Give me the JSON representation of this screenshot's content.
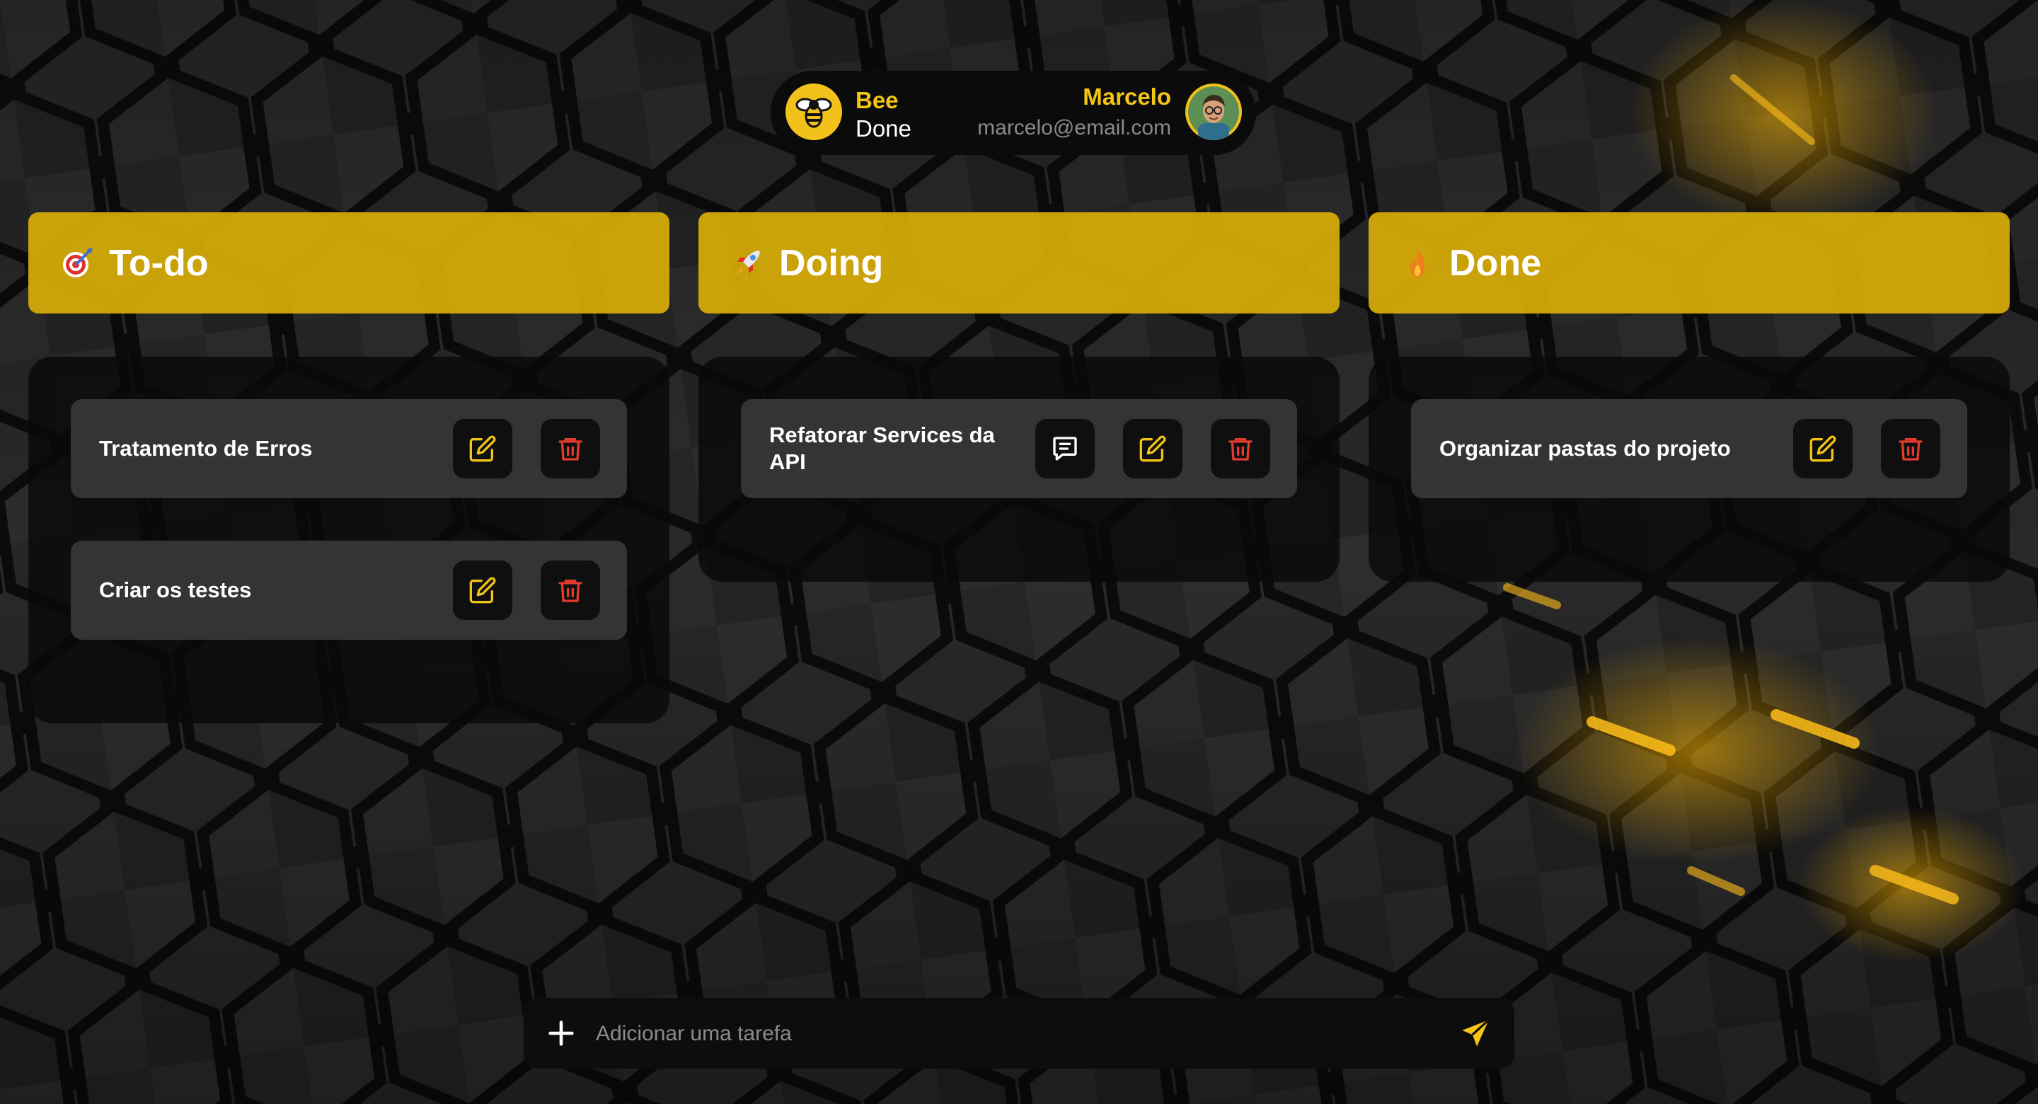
{
  "brand": {
    "line1": "Bee",
    "line2": "Done"
  },
  "user": {
    "name": "Marcelo",
    "email": "marcelo@email.com"
  },
  "columns": [
    {
      "title": "To-do",
      "icon": "target-icon",
      "cards": [
        {
          "title": "Tratamento de Erros"
        },
        {
          "title": "Criar os testes"
        }
      ]
    },
    {
      "title": "Doing",
      "icon": "rocket-icon",
      "cards": [
        {
          "title": "Refatorar Services da API"
        }
      ]
    },
    {
      "title": "Done",
      "icon": "fire-icon",
      "cards": [
        {
          "title": "Organizar pastas do projeto"
        }
      ]
    }
  ],
  "add_task": {
    "placeholder": "Adicionar uma tarefa"
  },
  "colors": {
    "accent": "#f3c515",
    "delete": "#e23b2e",
    "header_bg": "#d4aa08"
  }
}
